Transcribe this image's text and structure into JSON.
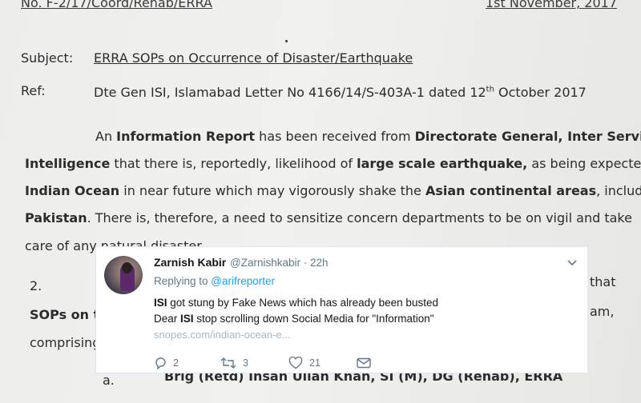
{
  "document": {
    "header_ref": "No. F-2/17/Coord/Rehab/ERRA",
    "header_date": "1st November, 2017",
    "subject_label": "Subject:",
    "subject_text": "ERRA SOPs on Occurrence of Disaster/Earthquake",
    "ref_label": "Ref:",
    "ref_text_a": "Dte Gen ISI, Islamabad Letter No 4166/14/S-403A-1 dated 12",
    "ref_sup": "th",
    "ref_text_b": " October 2017",
    "p1_l1_a": "An ",
    "p1_l1_b": "Information Report",
    "p1_l1_c": " has been received from ",
    "p1_l1_d": "Directorate General, Inter Services",
    "p1_l2_a": "Intelligence",
    "p1_l2_b": " that there is, reportedly, likelihood of ",
    "p1_l2_c": "large scale earthquake,",
    "p1_l2_d": " as being expected, in",
    "p1_l3_a": "Indian Ocean",
    "p1_l3_b": " in near future which may vigorously shake the ",
    "p1_l3_c": "Asian continental areas",
    "p1_l3_d": ", including",
    "p1_l4_a": "Pakistan",
    "p1_l4_b": ". There is, therefore, a need to sensitize concern departments to be on vigil and take",
    "p1_l5": "care of any natural disaster.",
    "p2_num": "2.",
    "p2_right": "that",
    "sops_left": "SOPs on t",
    "sops_right": "am,",
    "comprising": "comprising",
    "item_a_label": "a.",
    "item_a_text": "Brig (Retd) Ihsan Ullah Khan, SI (M), DG (Rehab), ERRA"
  },
  "tweet": {
    "name": "Zarnish Kabir",
    "handle_time": "@Zarnishkabir · 22h",
    "replying_prefix": "Replying to ",
    "replying_handle": "@arifreporter",
    "line1_bold": "ISI",
    "line1_rest": " got stung by Fake News which has already been busted",
    "line2_a": "Dear ",
    "line2_bold": "ISI",
    "line2_rest": " stop scrolling down Social Media for \"Information\"",
    "link": "snopes.com/indian-ocean-e...",
    "reply_count": "2",
    "retweet_count": "3",
    "like_count": "21",
    "icons": [
      "reply-icon",
      "retweet-icon",
      "like-icon",
      "message-icon",
      "chevron-down-icon"
    ],
    "colors": {
      "link": "#1da1f2",
      "muted": "#657786"
    }
  }
}
